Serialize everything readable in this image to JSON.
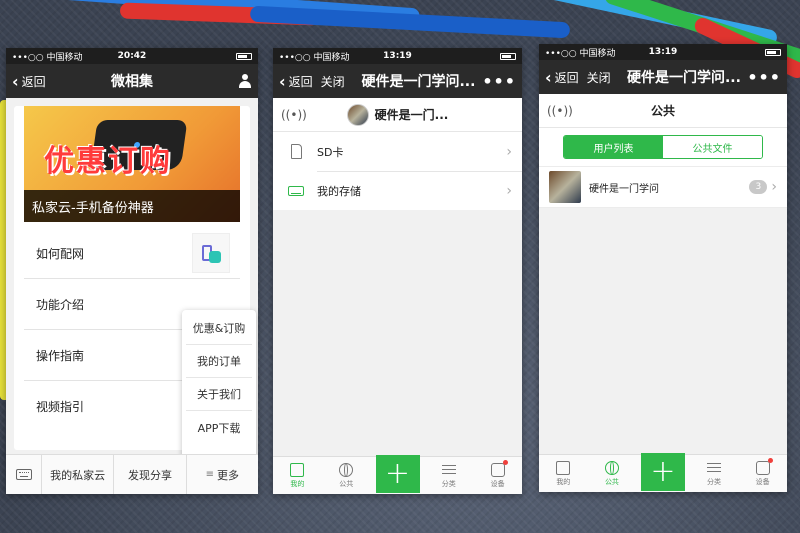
{
  "phone1": {
    "status": {
      "carrier": "•••○○ 中国移动",
      "time": "20:42"
    },
    "nav": {
      "back": "返回",
      "title": "微相集"
    },
    "banner": {
      "promo": "优惠订购",
      "caption": "私家云-手机备份神器"
    },
    "menu": [
      {
        "label": "如何配网"
      },
      {
        "label": "功能介绍"
      },
      {
        "label": "操作指南"
      },
      {
        "label": "视频指引"
      }
    ],
    "popup": [
      "优惠&订购",
      "我的订单",
      "关于我们",
      "APP下载"
    ],
    "tabbar": [
      "我的私家云",
      "发现分享",
      "更多"
    ]
  },
  "phone2": {
    "status": {
      "carrier": "•••○○ 中国移动",
      "time": "13:19"
    },
    "nav": {
      "back": "返回",
      "close": "关闭",
      "title": "硬件是一门学问...",
      "more": "•••"
    },
    "header_name": "硬件是一门...",
    "storage": [
      {
        "label": "SD卡",
        "icon": "sd-card-icon"
      },
      {
        "label": "我的存储",
        "icon": "drive-icon"
      }
    ],
    "tabs": [
      {
        "label": "我的",
        "icon": "folder-icon"
      },
      {
        "label": "公共",
        "icon": "globe-icon"
      },
      {
        "label": "+",
        "icon": "plus-icon"
      },
      {
        "label": "分类",
        "icon": "list-icon"
      },
      {
        "label": "设备",
        "icon": "device-icon"
      }
    ]
  },
  "phone3": {
    "status": {
      "carrier": "•••○○ 中国移动",
      "time": "13:19"
    },
    "nav": {
      "back": "返回",
      "close": "关闭",
      "title": "硬件是一门学问...",
      "more": "•••"
    },
    "header_title": "公共",
    "segments": [
      "用户列表",
      "公共文件"
    ],
    "user": {
      "name": "硬件是一门学问",
      "count": "3"
    },
    "tabs": [
      {
        "label": "我的",
        "icon": "folder-icon"
      },
      {
        "label": "公共",
        "icon": "globe-icon"
      },
      {
        "label": "+",
        "icon": "plus-icon"
      },
      {
        "label": "分类",
        "icon": "list-icon"
      },
      {
        "label": "设备",
        "icon": "device-icon"
      }
    ]
  },
  "colors": {
    "accent": "#2fb84a",
    "navbar": "#2b2b2b",
    "badge_red": "#f0403c"
  }
}
